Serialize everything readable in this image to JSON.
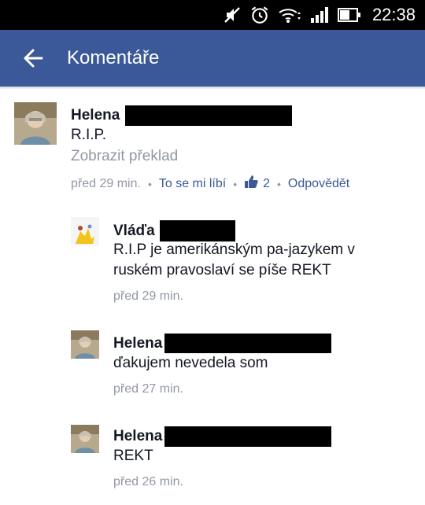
{
  "status_bar": {
    "time": "22:38"
  },
  "app_bar": {
    "title": "Komentáře"
  },
  "comments": [
    {
      "author": "Helena",
      "text": "R.I.P.",
      "translate": "Zobrazit překlad",
      "time": "před 29 min.",
      "like": "To se mi líbí",
      "likes": "2",
      "reply": "Odpovědět"
    }
  ],
  "replies": [
    {
      "author": "Vláďa",
      "text_line1": "R.I.P je amerikánským pa-jazykem v",
      "text_line2": "ruském pravoslaví se píše REKT",
      "time": "před 29 min."
    },
    {
      "author": "Helena",
      "text": "ďakujem nevedela som",
      "time": "před 27 min."
    },
    {
      "author": "Helena",
      "text": "REKT",
      "time": "před 26 min."
    }
  ],
  "colors": {
    "app_bar": "#3b5998",
    "link": "#3b5998",
    "meta": "#9197a3"
  }
}
